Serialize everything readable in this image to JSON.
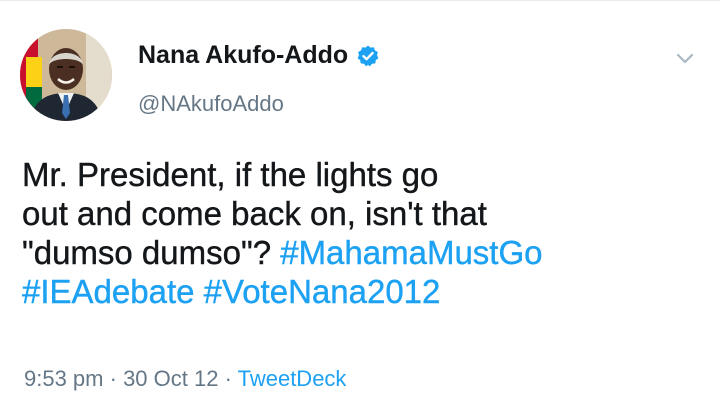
{
  "tweet": {
    "display_name": "Nana Akufo-Addo",
    "handle": "@NAkufoAddo",
    "verified": true,
    "lines": [
      {
        "parts": [
          {
            "type": "text",
            "value": "Mr. President, if the lights go"
          }
        ]
      },
      {
        "parts": [
          {
            "type": "text",
            "value": "out and come back on, isn't that"
          }
        ]
      },
      {
        "parts": [
          {
            "type": "text",
            "value": "\"dumso dumso\"? "
          },
          {
            "type": "hashtag",
            "value": "#MahamaMustGo"
          }
        ]
      },
      {
        "parts": [
          {
            "type": "hashtag",
            "value": "#IEAdebate"
          },
          {
            "type": "text",
            "value": " "
          },
          {
            "type": "hashtag",
            "value": "#VoteNana2012"
          }
        ]
      }
    ],
    "time": "9:53 pm",
    "separator": " · ",
    "date": "30 Oct 12",
    "source": "TweetDeck"
  },
  "icons": {
    "verified": "verified-badge-icon",
    "menu": "chevron-down-icon"
  },
  "colors": {
    "accent": "#1da1f2",
    "text": "#14171a",
    "muted": "#657786"
  }
}
